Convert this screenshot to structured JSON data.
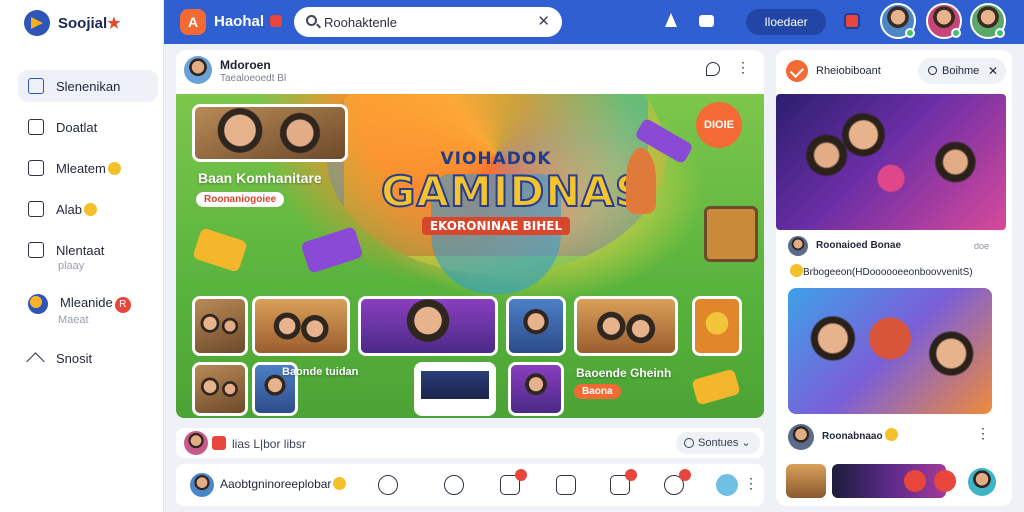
{
  "brand": {
    "name": "Soojial",
    "mark": "★"
  },
  "sidebar": {
    "items": [
      {
        "label": "Slenenikan",
        "sub": ""
      },
      {
        "label": "Doatlat",
        "sub": ""
      },
      {
        "label": "Mleatem",
        "sub": ""
      },
      {
        "label": "Alab",
        "sub": ""
      },
      {
        "label": "Nlentaat",
        "sub": "plaay"
      },
      {
        "label": "Mleanide",
        "sub": "Maeat",
        "badge": "R"
      },
      {
        "label": "Snosit",
        "sub": ""
      }
    ]
  },
  "topbar": {
    "logo_letter": "A",
    "title": "Haohal",
    "search": {
      "value": "Roohaktenle",
      "placeholder": "Search"
    },
    "signin_label": "Iloedaer",
    "accent": "#2f5fd0"
  },
  "post": {
    "author": "Mdoroen",
    "meta": "Taealoeoedt Bl",
    "banner": {
      "title_line1": "VIOHADOK",
      "title_line2": "GAMIDNAS",
      "title_line3": "EKORONINAE BIHEL",
      "corner_tag": "DIOIE",
      "left_heading": "Baan Komhanitare",
      "left_pill": "Roonaniogoiee",
      "lower_left_text": "Baonde tuidan",
      "lower_right_text": "Baoende Gheinh",
      "lower_right_pill": "Baona"
    }
  },
  "reply_bar": {
    "text": "lias   L|bor   libsr",
    "filter_label": "Sontues"
  },
  "actionbar": {
    "text": "Aaobtgninoreeplobar"
  },
  "right_panel": {
    "title": "Rheiobiboant",
    "button_label": "Boihme",
    "post1": {
      "name": "Roonaioed Bonae",
      "time": "doe",
      "caption": "Brbogeeon(HDoooooeeonboovvenitS)"
    },
    "post2": {
      "name": "Roonabnaao"
    }
  }
}
